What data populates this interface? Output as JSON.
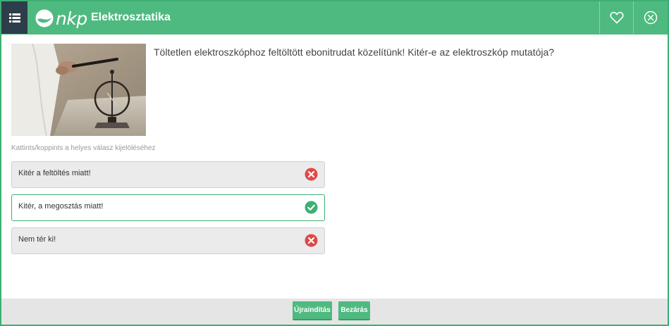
{
  "header": {
    "logo_text": "nkp",
    "title": "Elektrosztatika",
    "menu_icon": "list-icon",
    "favorite_icon": "heart-icon",
    "close_icon": "close-circle-icon"
  },
  "question": {
    "text": "Töltetlen elektroszkóphoz feltöltött ebonitrudat közelítünk! Kitér-e az elektroszkóp mutatója?",
    "image": "electroscope-photo"
  },
  "instruction": "Kattints/koppints a helyes válasz kijelöléséhez",
  "answers": [
    {
      "label": "Kitér a feltöltés miatt!",
      "status": "wrong",
      "icon": "x-circle-icon"
    },
    {
      "label": "Kitér, a megosztás miatt!",
      "status": "correct",
      "icon": "check-circle-icon"
    },
    {
      "label": "Nem tér ki!",
      "status": "wrong",
      "icon": "x-circle-icon"
    }
  ],
  "footer": {
    "restart_label": "Újraindítás",
    "close_label": "Bezárás"
  },
  "colors": {
    "brand_green": "#4fba80",
    "menu_dark": "#2d3d4a",
    "correct": "#3daf72",
    "wrong": "#e04848"
  }
}
